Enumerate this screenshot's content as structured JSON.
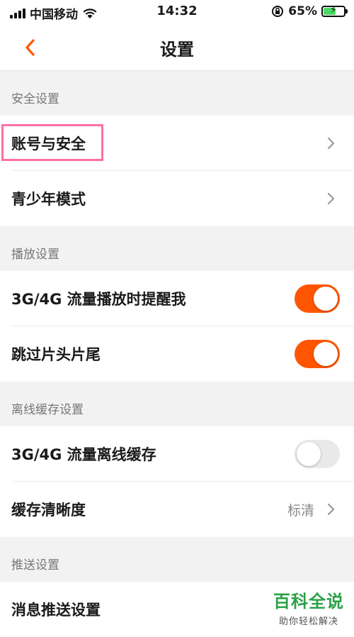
{
  "status_bar": {
    "carrier": "中国移动",
    "time": "14:32",
    "battery_percent": "65%",
    "battery_level": 0.65,
    "icons": [
      "signal-icon",
      "wifi-icon",
      "orientation-lock-icon",
      "battery-charging-icon"
    ]
  },
  "nav": {
    "title": "设置",
    "back_icon": "chevron-left-icon"
  },
  "colors": {
    "accent": "#ff5500",
    "highlight": "#ff6fa5",
    "watermark": "#2aa148"
  },
  "sections": {
    "security": {
      "header": "安全设置",
      "account_security": "账号与安全",
      "youth_mode": "青少年模式"
    },
    "playback": {
      "header": "播放设置",
      "mobile_data_reminder": "3G/4G 流量播放时提醒我",
      "mobile_data_reminder_on": true,
      "skip_intro_outro": "跳过片头片尾",
      "skip_intro_outro_on": true
    },
    "offline_cache": {
      "header": "离线缓存设置",
      "mobile_data_cache": "3G/4G 流量离线缓存",
      "mobile_data_cache_on": false,
      "cache_quality": "缓存清晰度",
      "cache_quality_value": "标清"
    },
    "push": {
      "header": "推送设置",
      "message_push": "消息推送设置"
    }
  },
  "watermark": {
    "brand": "百科全说",
    "slogan": "助你轻松解决"
  }
}
